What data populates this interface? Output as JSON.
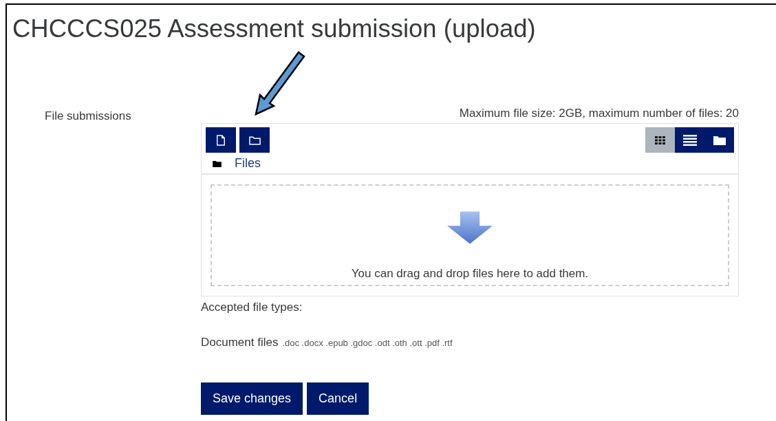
{
  "page": {
    "title": "CHCCCS025 Assessment submission (upload)"
  },
  "form": {
    "label": "File submissions",
    "limits": "Maximum file size: 2GB, maximum number of files: 20",
    "toolbar": [
      {
        "kind": "file"
      },
      {
        "kind": "folder"
      }
    ],
    "view_modes": [
      {
        "kind": "grid",
        "selected": true
      },
      {
        "kind": "list",
        "selected": false
      },
      {
        "kind": "tree",
        "selected": false
      }
    ],
    "path": "Files",
    "dropzone": "You can drag and drop files here to add them.",
    "accepted_heading": "Accepted file types:",
    "accepted": [
      {
        "name": "Document files",
        "extensions": ".doc .docx .epub .gdoc .odt .oth .ott .pdf .rtf"
      }
    ]
  },
  "buttons": [
    {
      "label": "Save changes"
    },
    {
      "label": "Cancel"
    }
  ]
}
